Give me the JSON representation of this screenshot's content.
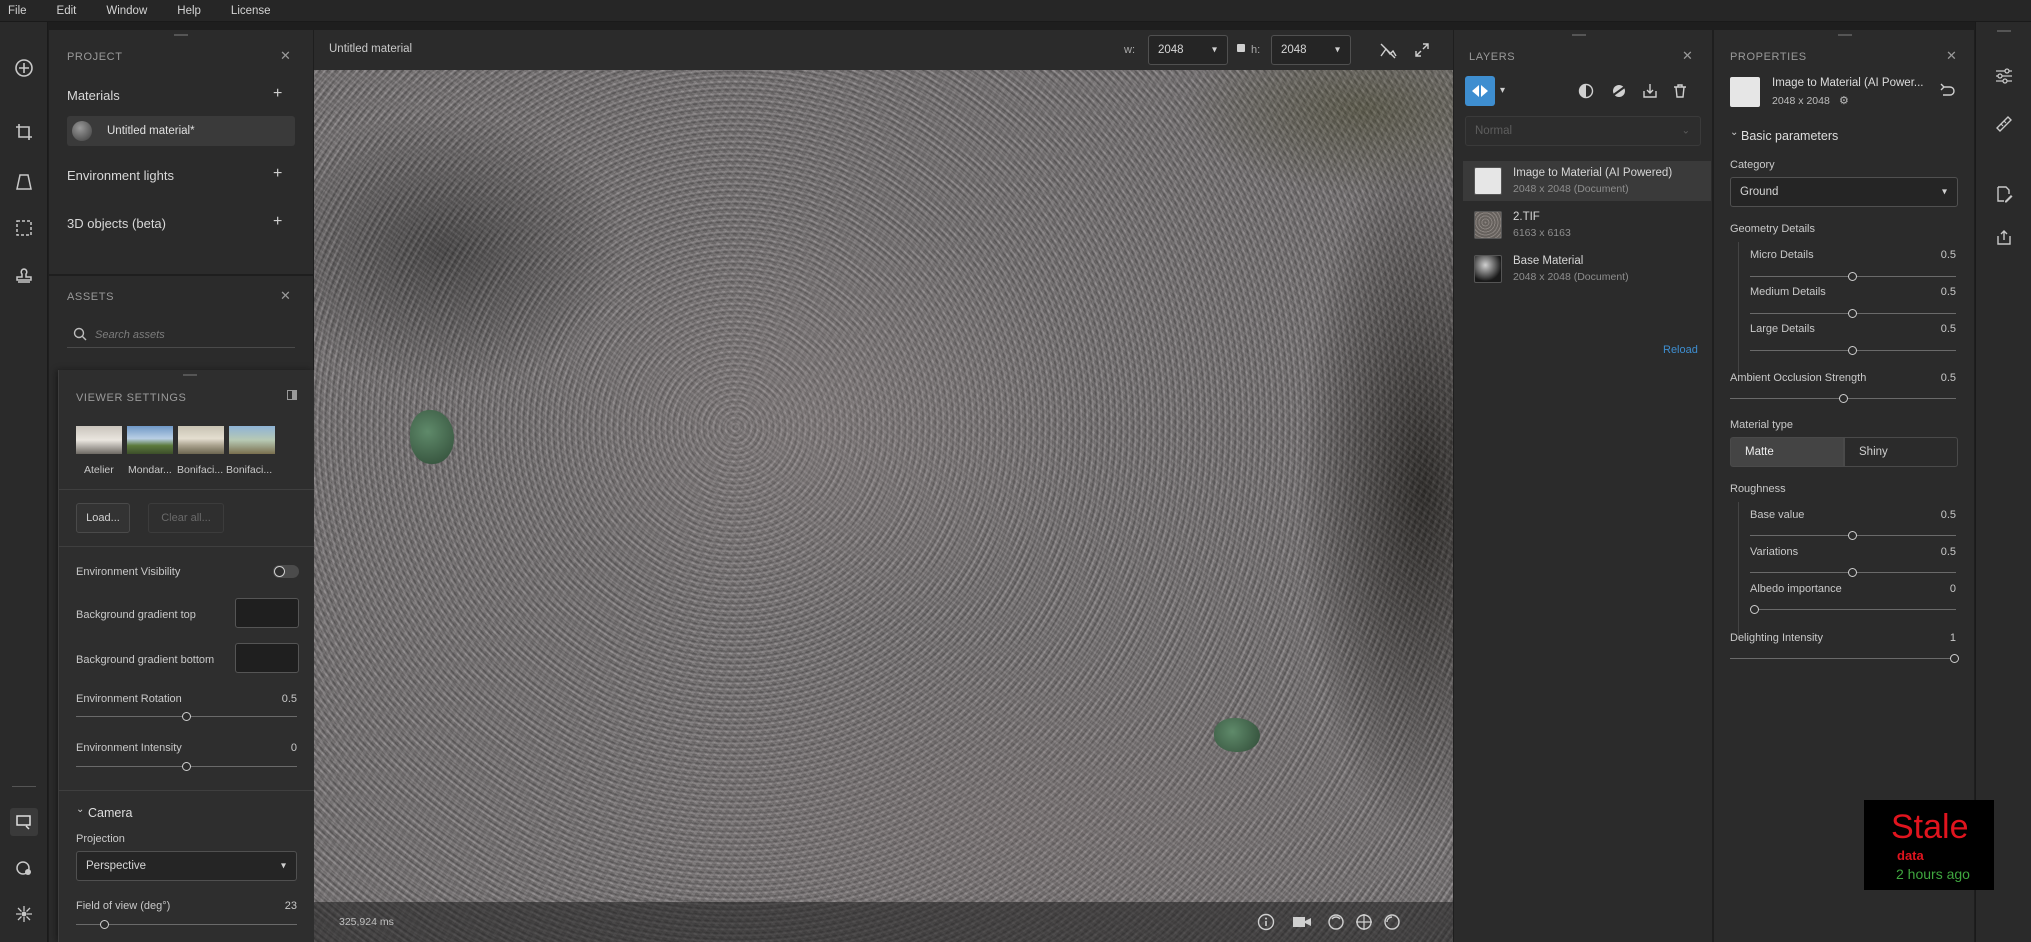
{
  "menu": [
    "File",
    "Edit",
    "Window",
    "Help",
    "License"
  ],
  "project": {
    "title": "PROJECT",
    "materials_label": "Materials",
    "material_item": "Untitled material*",
    "env_lights_label": "Environment lights",
    "objects_label": "3D objects (beta)"
  },
  "assets": {
    "title": "ASSETS",
    "search_placeholder": "Search assets"
  },
  "viewer": {
    "title": "VIEWER SETTINGS",
    "envs": [
      "Atelier",
      "Mondar...",
      "Bonifaci...",
      "Bonifaci..."
    ],
    "load_label": "Load...",
    "clear_label": "Clear all...",
    "env_visibility": "Environment Visibility",
    "bg_top": "Background gradient top",
    "bg_bottom": "Background gradient bottom",
    "env_rotation": "Environment Rotation",
    "env_rotation_val": "0.5",
    "env_intensity": "Environment Intensity",
    "env_intensity_val": "0",
    "camera_label": "Camera",
    "projection_label": "Projection",
    "projection_val": "Perspective",
    "fov_label": "Field of view (deg°)",
    "fov_val": "23"
  },
  "document": {
    "title": "Untitled material",
    "w_label": "w:",
    "w_val": "2048",
    "h_label": "h:",
    "h_val": "2048",
    "render_time": "325,924 ms"
  },
  "layers": {
    "title": "LAYERS",
    "blend_mode": "Normal",
    "items": [
      {
        "name": "Image to Material (AI Powered)",
        "sub": "2048 x 2048 (Document)"
      },
      {
        "name": "2.TIF",
        "sub": "6163 x 6163"
      },
      {
        "name": "Base Material",
        "sub": "2048 x 2048 (Document)"
      }
    ],
    "reload_label": "Reload"
  },
  "properties": {
    "title": "PROPERTIES",
    "layer_name": "Image to Material (AI Power...",
    "layer_size": "2048 x 2048",
    "section": "Basic parameters",
    "category_label": "Category",
    "category_val": "Ground",
    "geometry_label": "Geometry Details",
    "micro_label": "Micro Details",
    "micro_val": "0.5",
    "medium_label": "Medium Details",
    "medium_val": "0.5",
    "large_label": "Large Details",
    "large_val": "0.5",
    "ao_label": "Ambient Occlusion Strength",
    "ao_val": "0.5",
    "mat_type_label": "Material type",
    "matte_label": "Matte",
    "shiny_label": "Shiny",
    "roughness_label": "Roughness",
    "base_label": "Base value",
    "base_val": "0.5",
    "var_label": "Variations",
    "var_val": "0.5",
    "albedo_label": "Albedo importance",
    "albedo_val": "0",
    "delight_label": "Delighting Intensity",
    "delight_val": "1"
  },
  "stale": {
    "title": "Stale",
    "sub": "data",
    "time": "2 hours ago"
  },
  "colors": {
    "accent": "#3e8ed0",
    "stale_red": "#e0141e",
    "stale_green": "#3fa63f"
  }
}
